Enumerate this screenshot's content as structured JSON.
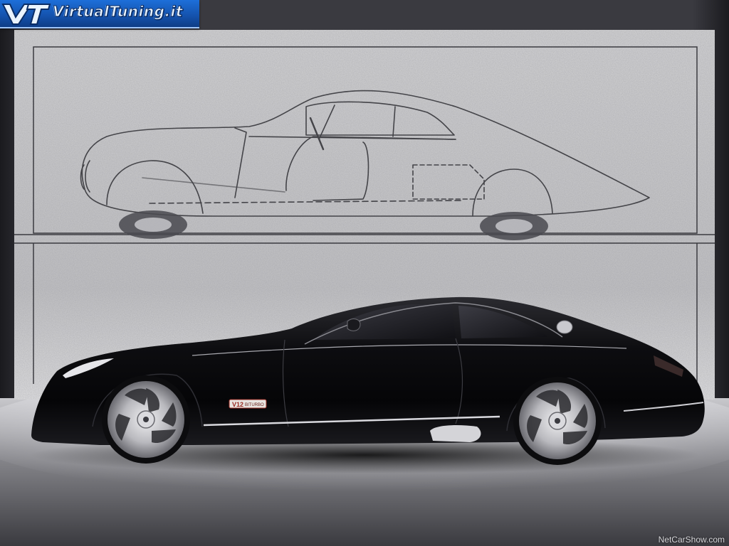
{
  "logo": {
    "text": "VirtualTuning.it",
    "icon": "vt-logo-mark"
  },
  "watermark": {
    "text": "NetCarShow.com"
  },
  "car": {
    "badge_text": "V12",
    "badge_subtext": "BITURBO"
  },
  "colors": {
    "car_body": "#121214",
    "backdrop_panel": "#c9c9cb",
    "floor": "#6f6f74",
    "logo_blue": "#1554b0"
  }
}
